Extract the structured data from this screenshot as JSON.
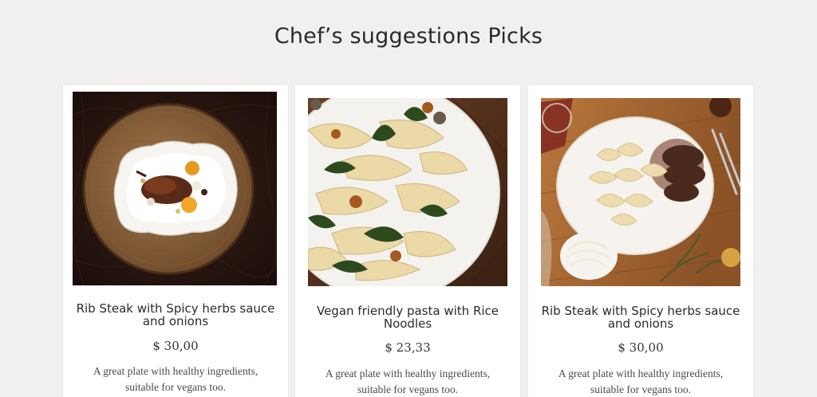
{
  "section": {
    "title": "Chef’s suggestions Picks"
  },
  "cards": [
    {
      "title": "Rib Steak with Spicy herbs sauce and onions",
      "price": "$ 30,00",
      "description": "A great plate with healthy ingredients, suitable for vegans too.",
      "image_icon": "duck-plate-photo"
    },
    {
      "title": "Vegan friendly pasta with Rice Noodles",
      "price": "$ 23,33",
      "description": "A great plate with healthy ingredients, suitable for vegans too.",
      "image_icon": "pasta-plate-photo"
    },
    {
      "title": "Rib Steak with Spicy herbs sauce and onions",
      "price": "$ 30,00",
      "description": "A great plate with healthy ingredients, suitable for vegans too.",
      "image_icon": "steak-ravioli-photo"
    }
  ],
  "colors": {
    "page_background": "#f1f0ee",
    "card_background": "#ffffff",
    "heading": "#2a2a2a"
  }
}
